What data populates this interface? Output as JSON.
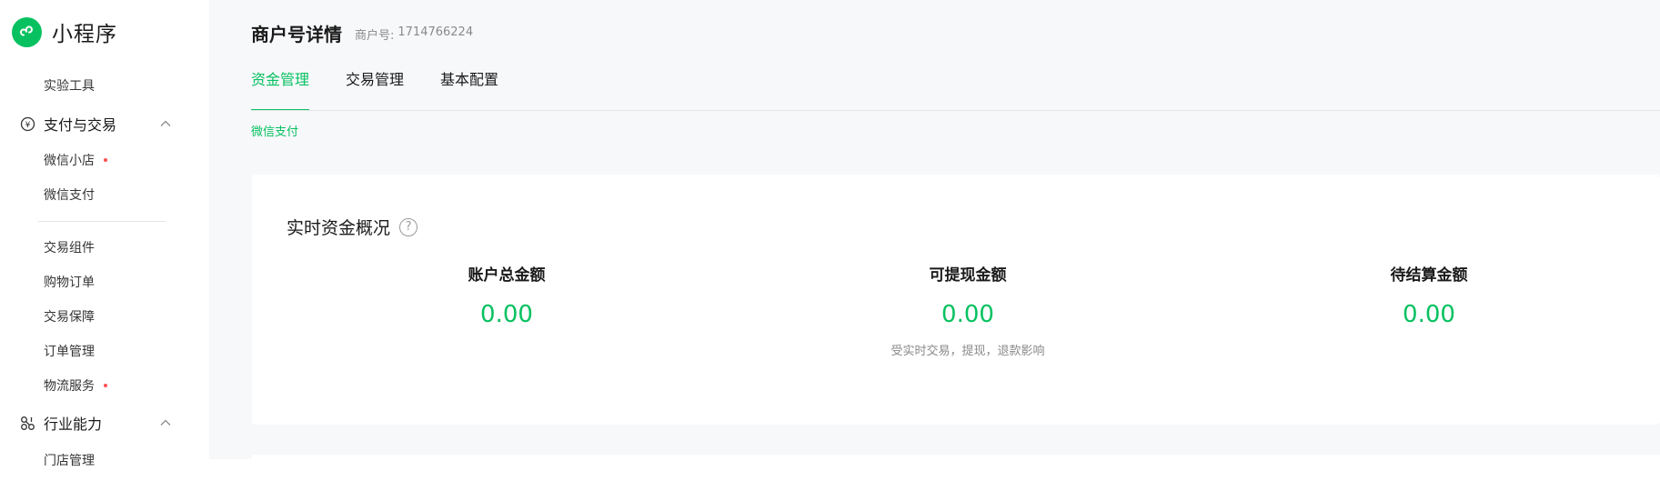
{
  "app": {
    "name": "小程序",
    "brand_color": "#07c160",
    "logo_icon": "mini-program-logo-icon"
  },
  "sidebar": {
    "top_items": [
      {
        "label": "实验工具"
      }
    ],
    "groups": [
      {
        "label": "支付与交易",
        "icon": "yen-circle-icon",
        "expanded": true,
        "items": [
          {
            "label": "微信小店",
            "dot": true
          },
          {
            "label": "微信支付",
            "dot": false
          },
          {
            "label": "交易组件",
            "dot": false
          },
          {
            "label": "购物订单",
            "dot": false
          },
          {
            "label": "交易保障",
            "dot": false
          },
          {
            "label": "订单管理",
            "dot": false
          },
          {
            "label": "物流服务",
            "dot": true
          }
        ]
      },
      {
        "label": "行业能力",
        "icon": "industry-nodes-icon",
        "expanded": true,
        "items": [
          {
            "label": "门店管理",
            "dot": false
          }
        ]
      }
    ],
    "dot_color": "#fa5151"
  },
  "header": {
    "title": "商户号详情",
    "merchant_label": "商户号:",
    "merchant_id": "1714766224"
  },
  "tabs": [
    {
      "label": "资金管理",
      "active": true
    },
    {
      "label": "交易管理",
      "active": false
    },
    {
      "label": "基本配置",
      "active": false
    }
  ],
  "sub_tab": {
    "label": "微信支付"
  },
  "overview": {
    "title": "实时资金概况",
    "help_icon": "question-circle-icon",
    "stats": [
      {
        "label": "账户总金额",
        "value": "0.00",
        "note": ""
      },
      {
        "label": "可提现金额",
        "value": "0.00",
        "note": "受实时交易，提现，退款影响"
      },
      {
        "label": "待结算金额",
        "value": "0.00",
        "note": ""
      }
    ]
  }
}
